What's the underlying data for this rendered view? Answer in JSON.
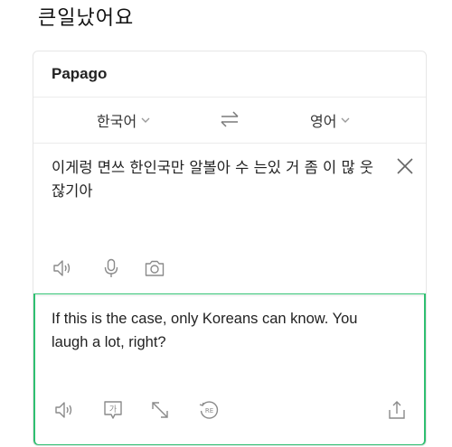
{
  "post": {
    "title": "큰일났어요"
  },
  "app": {
    "title": "Papago"
  },
  "languages": {
    "source": "한국어",
    "target": "영어"
  },
  "source": {
    "text": "이게렁 면쓰 한인국만 알볼아 수 는있 거 좀 이 많 웃잖기아"
  },
  "translation": {
    "text": "If this is the case, only Koreans can know. You laugh a lot, right?"
  },
  "icons": {
    "source_tools": [
      "speaker-icon",
      "microphone-icon",
      "camera-icon"
    ],
    "target_tools": [
      "speaker-icon",
      "honorific-icon",
      "expand-icon",
      "retranslate-icon",
      "share-icon"
    ],
    "honorific_glyph": "가",
    "retranslate_glyph": "RE"
  },
  "colors": {
    "accent_green": "#2fbf71",
    "icon_gray": "#8a8a8a"
  }
}
